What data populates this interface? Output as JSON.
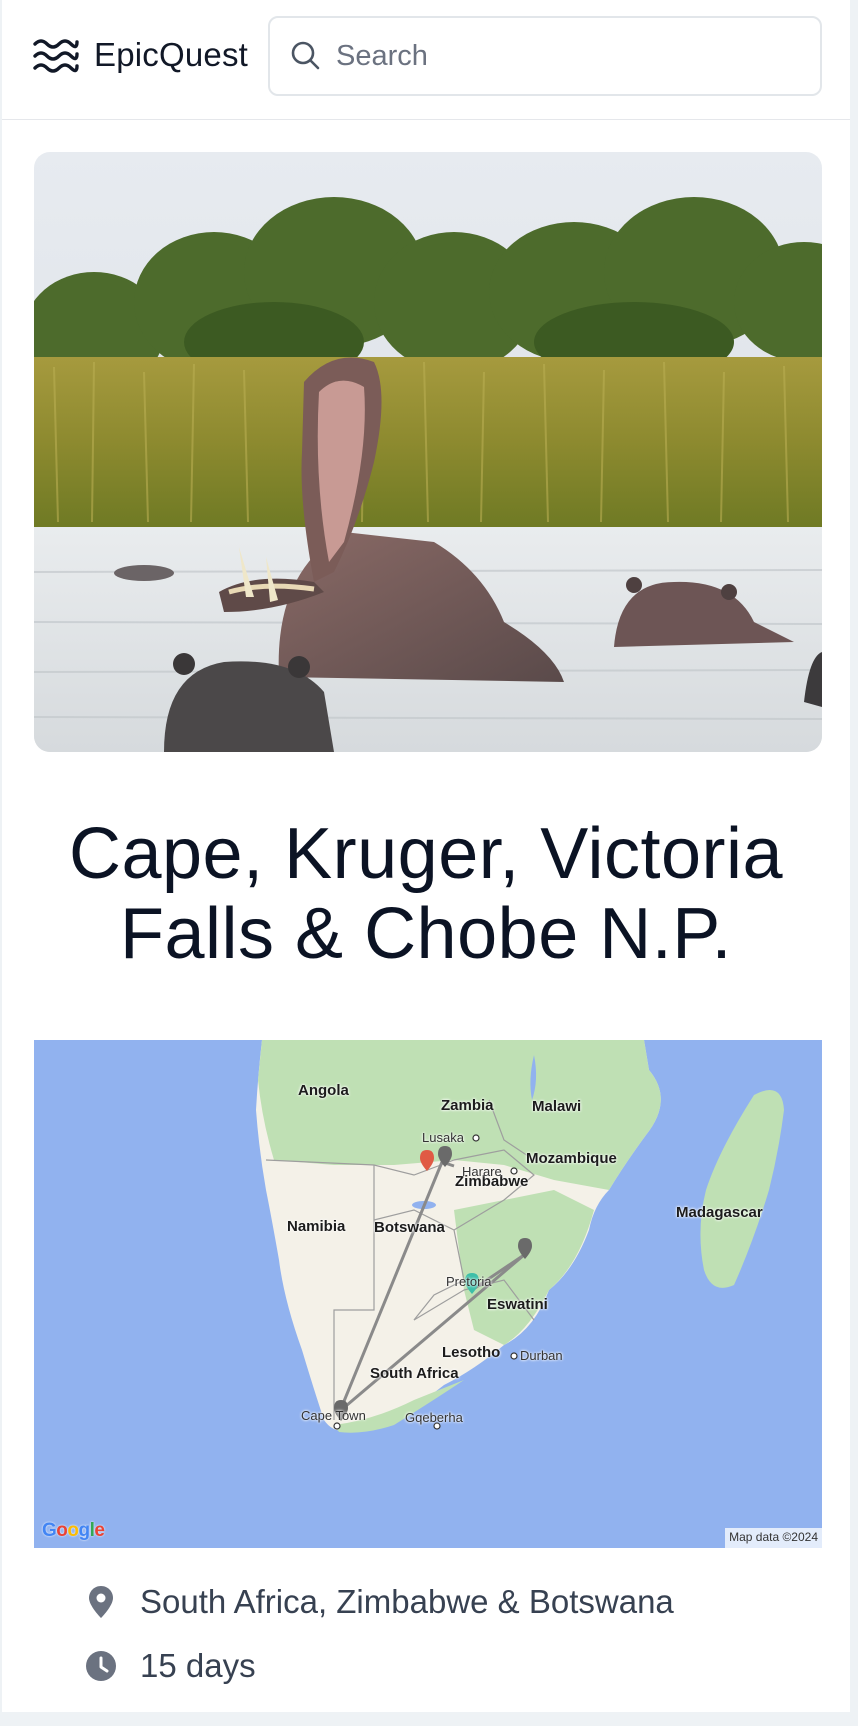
{
  "header": {
    "brand": "EpicQuest",
    "logo_icon": "waves-icon",
    "search": {
      "placeholder": "Search",
      "value": "",
      "icon": "search-icon"
    }
  },
  "hero": {
    "alt": "Hippos in a river, one yawning widely",
    "icon": "photo"
  },
  "trip": {
    "title": "Cape, Kruger, Victoria Falls & Chobe N.P.",
    "location": "South Africa, Zimbabwe & Botswana",
    "location_icon": "map-pin-icon",
    "duration": "15 days",
    "duration_icon": "clock-icon"
  },
  "map": {
    "countries": [
      "Angola",
      "Zambia",
      "Malawi",
      "Mozambique",
      "Zimbabwe",
      "Namibia",
      "Botswana",
      "Madagascar",
      "Eswatini",
      "Lesotho",
      "South Africa"
    ],
    "cities": [
      "Lusaka",
      "Harare",
      "Pretoria",
      "Durban",
      "Cape Town",
      "Gqeberha"
    ],
    "provider": "Google",
    "credit": "Map data ©2024",
    "colors": {
      "water": "#91b2ef",
      "land": "#f4f1e8",
      "green": "#bfe0b4",
      "route": "#8a8a8a",
      "marker_start": "#e05a44",
      "marker_mid": "#6a6a6a",
      "marker_end": "#3dbfa8"
    }
  }
}
